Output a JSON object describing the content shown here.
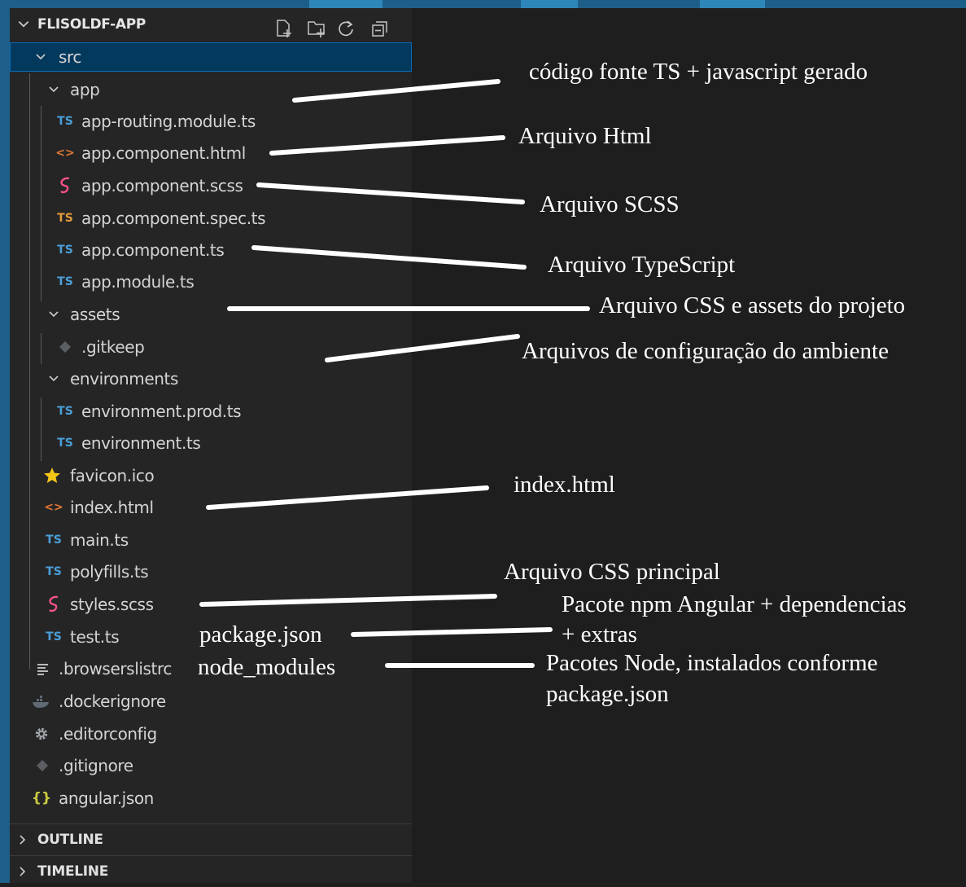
{
  "explorer": {
    "title": "FLISOLDF-APP",
    "actions": [
      "new-file-icon",
      "new-folder-icon",
      "refresh-icon",
      "collapse-all-icon"
    ],
    "tree": [
      {
        "label": "src",
        "kind": "folder",
        "icon": "chevron-down-icon",
        "selected": true
      },
      {
        "label": "app",
        "kind": "folder",
        "icon": "chevron-down-icon"
      },
      {
        "label": "app-routing.module.ts",
        "kind": "ts",
        "icon": "TS"
      },
      {
        "label": "app.component.html",
        "kind": "html",
        "icon": "<>"
      },
      {
        "label": "app.component.scss",
        "kind": "scss",
        "icon": "sass-icon"
      },
      {
        "label": "app.component.spec.ts",
        "kind": "spec",
        "icon": "TS"
      },
      {
        "label": "app.component.ts",
        "kind": "ts",
        "icon": "TS"
      },
      {
        "label": "app.module.ts",
        "kind": "ts",
        "icon": "TS"
      },
      {
        "label": "assets",
        "kind": "folder",
        "icon": "chevron-down-icon"
      },
      {
        "label": ".gitkeep",
        "kind": "git",
        "icon": "git-diamond-icon"
      },
      {
        "label": "environments",
        "kind": "folder",
        "icon": "chevron-down-icon"
      },
      {
        "label": "environment.prod.ts",
        "kind": "ts",
        "icon": "TS"
      },
      {
        "label": "environment.ts",
        "kind": "ts",
        "icon": "TS"
      },
      {
        "label": "favicon.ico",
        "kind": "star",
        "icon": "star-icon"
      },
      {
        "label": "index.html",
        "kind": "html",
        "icon": "<>"
      },
      {
        "label": "main.ts",
        "kind": "ts",
        "icon": "TS"
      },
      {
        "label": "polyfills.ts",
        "kind": "ts",
        "icon": "TS"
      },
      {
        "label": "styles.scss",
        "kind": "scss",
        "icon": "sass-icon"
      },
      {
        "label": "test.ts",
        "kind": "ts",
        "icon": "TS"
      },
      {
        "label": ".browserslistrc",
        "kind": "list",
        "icon": "list-icon"
      },
      {
        "label": ".dockerignore",
        "kind": "docker",
        "icon": "docker-icon"
      },
      {
        "label": ".editorconfig",
        "kind": "gear",
        "icon": "gear-icon"
      },
      {
        "label": ".gitignore",
        "kind": "git",
        "icon": "git-diamond-icon"
      },
      {
        "label": "angular.json",
        "kind": "json",
        "icon": "{}"
      }
    ],
    "panels": [
      {
        "label": "OUTLINE",
        "icon": "chevron-right-icon"
      },
      {
        "label": "TIMELINE",
        "icon": "chevron-right-icon"
      }
    ]
  },
  "annotations": {
    "codigo": "código fonte TS + javascript gerado",
    "html": "Arquivo Html",
    "scss": "Arquivo SCSS",
    "typescript": "Arquivo TypeScript",
    "assets": "Arquivo CSS e assets do projeto",
    "environments": "Arquivos de configuração do ambiente",
    "index": "index.html",
    "styles": "Arquivo CSS principal",
    "package_json": "package.json",
    "angular_line1": "Pacote npm Angular + dependencias",
    "angular_line2": "+ extras",
    "node_modules": "node_modules",
    "node_line1": "Pacotes Node, instalados conforme",
    "node_line2": "package.json"
  },
  "colors": {
    "sidebar": "#252526",
    "editor": "#1e1e1e",
    "selection": "#04395e",
    "ts": "#4a9fd8",
    "spec_ts": "#e59b3b",
    "html": "#e37933",
    "scss": "#f55385",
    "star": "#f5c518",
    "json": "#cbcb41",
    "frame": "#1e5f8a"
  }
}
